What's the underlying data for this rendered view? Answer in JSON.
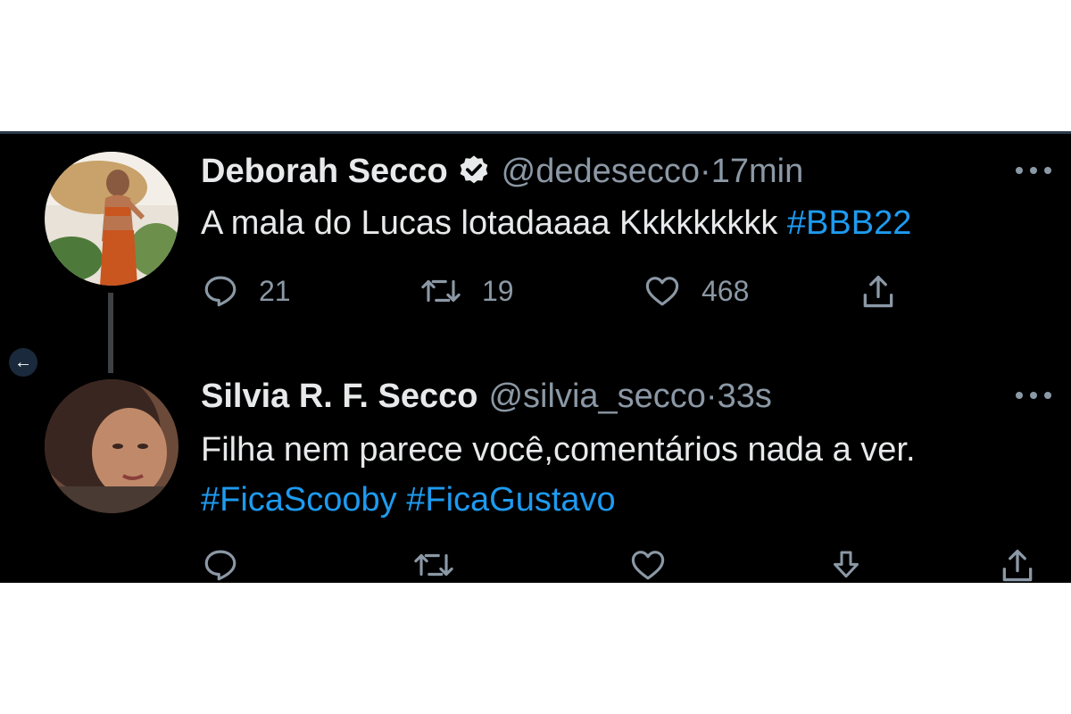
{
  "colors": {
    "background": "#000000",
    "text": "#e7e9ea",
    "secondary_text": "#8b98a5",
    "hashtag": "#1d9bf0"
  },
  "navigation": {
    "back_icon": "arrow-left-icon",
    "back_glyph": "←"
  },
  "tweets": [
    {
      "author_name": "Deborah Secco",
      "verified": true,
      "handle": "@dedesecco",
      "separator": "·",
      "time": "17min",
      "text": "A mala do Lucas lotadaaaa Kkkkkkkkk",
      "hashtags": [
        "#BBB22"
      ],
      "replies": "21",
      "retweets": "19",
      "likes": "468"
    },
    {
      "author_name": "Silvia R. F. Secco",
      "verified": false,
      "handle": "@silvia_secco",
      "separator": "·",
      "time": "33s",
      "text": "Filha nem parece você,comentários nada a ver.",
      "hashtags": [
        "#FicaScooby",
        "#FicaGustavo"
      ]
    }
  ]
}
